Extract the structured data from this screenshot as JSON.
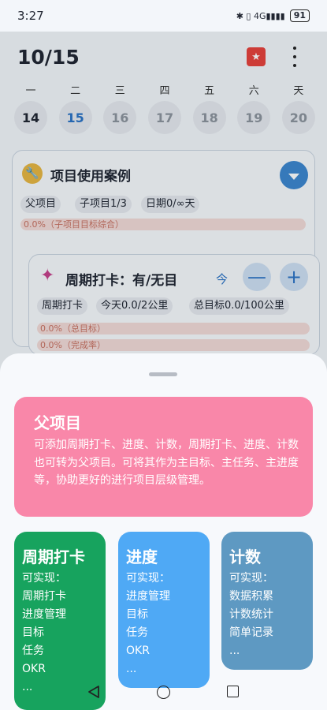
{
  "status_bar": {
    "time": "3:27",
    "icons": "✱ ▯ 4G▮▮▮▮",
    "battery": "91"
  },
  "header": {
    "date": "10/15"
  },
  "week": {
    "weekdays": [
      "一",
      "二",
      "三",
      "四",
      "五",
      "六",
      "天"
    ],
    "days": [
      "14",
      "15",
      "16",
      "17",
      "18",
      "19",
      "20"
    ]
  },
  "project": {
    "title": "项目使用案例",
    "tags": [
      "父项目",
      "子项目1/3",
      "日期0/∞天"
    ],
    "progress_label": "0.0%（子项目目标综合）"
  },
  "checkin": {
    "title": "周期打卡：有/无目",
    "today_label": "今",
    "minus": "—",
    "plus": "+",
    "tags": [
      "周期打卡",
      "今天0.0/2公里",
      "总目标0.0/100公里"
    ],
    "bar_total": "0.0%（总目标）",
    "bar_rate": "0.0%（完成率）"
  },
  "sheet": {
    "parent": {
      "title": "父项目",
      "desc": "可添加周期打卡、进度、计数，周期打卡、进度、计数也可转为父项目。可将其作为主目标、主任务、主进度等，协助更好的进行项目层级管理。"
    },
    "features": [
      {
        "title": "周期打卡",
        "items": [
          "可实现：",
          "周期打卡",
          "进度管理",
          "目标",
          "任务",
          "OKR",
          "..."
        ]
      },
      {
        "title": "进度",
        "items": [
          "可实现：",
          "进度管理",
          "目标",
          "任务",
          "OKR",
          "..."
        ]
      },
      {
        "title": "计数",
        "items": [
          "可实现：",
          "数据积累",
          "计数统计",
          "简单记录",
          "..."
        ]
      }
    ]
  },
  "colors": {
    "parent": "#f987a9",
    "checkin": "#17a35e",
    "progress": "#4fa9f5",
    "count": "#5e99c2"
  }
}
